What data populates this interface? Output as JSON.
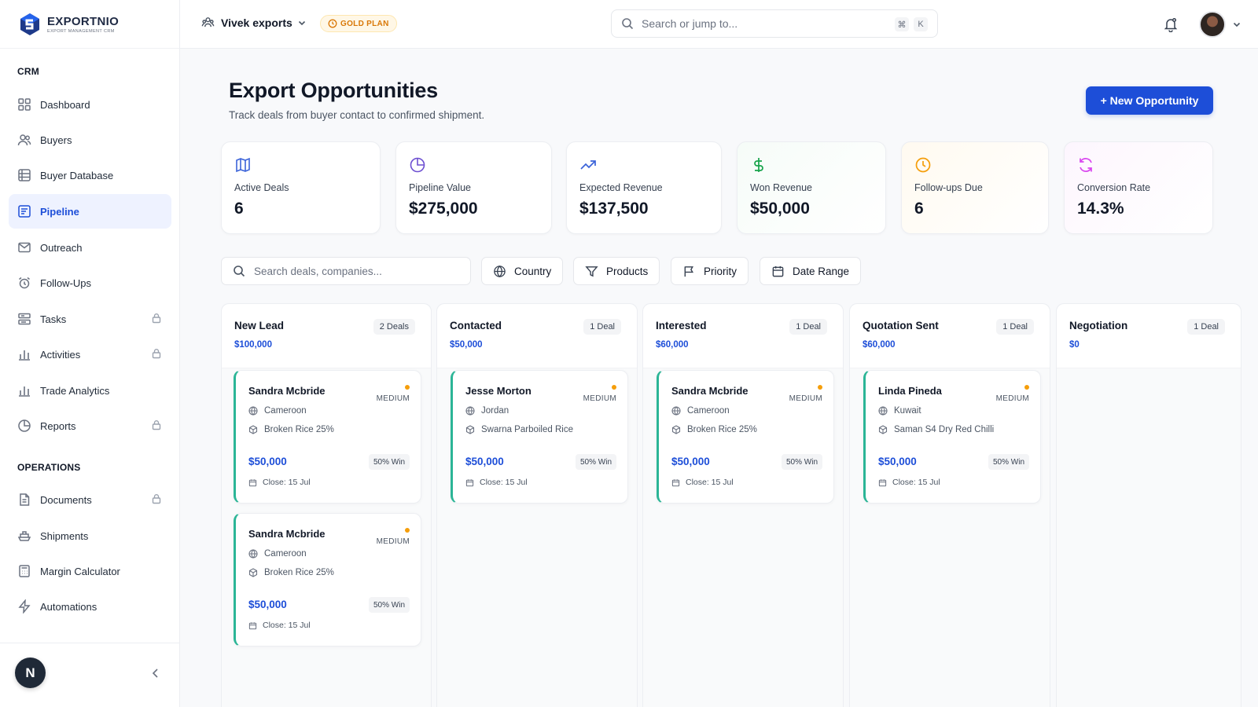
{
  "brand": {
    "name": "EXPORTNIO",
    "tagline": "EXPORT MANAGEMENT CRM"
  },
  "sidebar": {
    "sections": [
      {
        "title": "CRM"
      },
      {
        "title": "OPERATIONS"
      }
    ],
    "items": [
      {
        "label": "Dashboard",
        "icon": "grid-icon",
        "locked": false
      },
      {
        "label": "Buyers",
        "icon": "users-icon",
        "locked": false
      },
      {
        "label": "Buyer Database",
        "icon": "database-icon",
        "locked": false
      },
      {
        "label": "Pipeline",
        "icon": "pipeline-icon",
        "locked": false,
        "active": true
      },
      {
        "label": "Outreach",
        "icon": "mail-icon",
        "locked": false
      },
      {
        "label": "Follow-Ups",
        "icon": "alarm-icon",
        "locked": false
      },
      {
        "label": "Tasks",
        "icon": "tasks-icon",
        "locked": true
      },
      {
        "label": "Activities",
        "icon": "bar-chart-icon",
        "locked": true
      },
      {
        "label": "Trade Analytics",
        "icon": "bar-chart-icon",
        "locked": false
      },
      {
        "label": "Reports",
        "icon": "pie-chart-icon",
        "locked": true
      },
      {
        "label": "Documents",
        "icon": "document-icon",
        "locked": true
      },
      {
        "label": "Shipments",
        "icon": "ship-icon",
        "locked": false
      },
      {
        "label": "Margin Calculator",
        "icon": "calculator-icon",
        "locked": false
      },
      {
        "label": "Automations",
        "icon": "bolt-icon",
        "locked": false
      }
    ],
    "user_initial": "N"
  },
  "topbar": {
    "workspace": "Vivek exports",
    "plan": "GOLD PLAN",
    "search_placeholder": "Search or jump to...",
    "shortcut_keys": [
      "⌘",
      "K"
    ]
  },
  "page": {
    "title": "Export Opportunities",
    "subtitle": "Track deals from buyer contact to confirmed shipment.",
    "new_button": "+ New Opportunity"
  },
  "stats": [
    {
      "label": "Active Deals",
      "value": "6",
      "icon": "columns-icon",
      "color": "#3b63d9"
    },
    {
      "label": "Pipeline Value",
      "value": "$275,000",
      "icon": "pie-icon",
      "color": "#6d4fd1"
    },
    {
      "label": "Expected Revenue",
      "value": "$137,500",
      "icon": "trending-up-icon",
      "color": "#3b63d9"
    },
    {
      "label": "Won Revenue",
      "value": "$50,000",
      "icon": "dollar-icon",
      "color": "#16a34a"
    },
    {
      "label": "Follow-ups Due",
      "value": "6",
      "icon": "clock-icon",
      "color": "#f59e0b"
    },
    {
      "label": "Conversion Rate",
      "value": "14.3%",
      "icon": "refresh-icon",
      "color": "#d946ef"
    }
  ],
  "filters": {
    "search_placeholder": "Search deals, companies...",
    "buttons": [
      "Country",
      "Products",
      "Priority",
      "Date Range"
    ]
  },
  "columns": [
    {
      "title": "New Lead",
      "count": "2 Deals",
      "total": "$100,000"
    },
    {
      "title": "Contacted",
      "count": "1 Deal",
      "total": "$50,000"
    },
    {
      "title": "Interested",
      "count": "1 Deal",
      "total": "$60,000"
    },
    {
      "title": "Quotation Sent",
      "count": "1 Deal",
      "total": "$60,000"
    },
    {
      "title": "Negotiation",
      "count": "1 Deal",
      "total": "$0"
    }
  ],
  "cards": [
    {
      "name": "Sandra Mcbride",
      "priority": "MEDIUM",
      "country": "Cameroon",
      "product": "Broken Rice 25%",
      "amount": "$50,000",
      "win": "50% Win",
      "close": "Close: 15 Jul"
    },
    {
      "name": "Sandra Mcbride",
      "priority": "MEDIUM",
      "country": "Cameroon",
      "product": "Broken Rice 25%",
      "amount": "$50,000",
      "win": "50% Win",
      "close": "Close: 15 Jul"
    },
    {
      "name": "Jesse Morton",
      "priority": "MEDIUM",
      "country": "Jordan",
      "product": "Swarna Parboiled Rice",
      "amount": "$50,000",
      "win": "50% Win",
      "close": "Close: 15 Jul"
    },
    {
      "name": "Sandra Mcbride",
      "priority": "MEDIUM",
      "country": "Cameroon",
      "product": "Broken Rice 25%",
      "amount": "$50,000",
      "win": "50% Win",
      "close": "Close: 15 Jul"
    },
    {
      "name": "Linda Pineda",
      "priority": "MEDIUM",
      "country": "Kuwait",
      "product": "Saman S4 Dry Red Chilli",
      "amount": "$50,000",
      "win": "50% Win",
      "close": "Close: 15 Jul"
    }
  ],
  "colors": {
    "accent": "#1d4ed8",
    "active_bg": "#eef2ff",
    "card_border": "#2bb596",
    "priority_dot": "#f59e0b"
  }
}
